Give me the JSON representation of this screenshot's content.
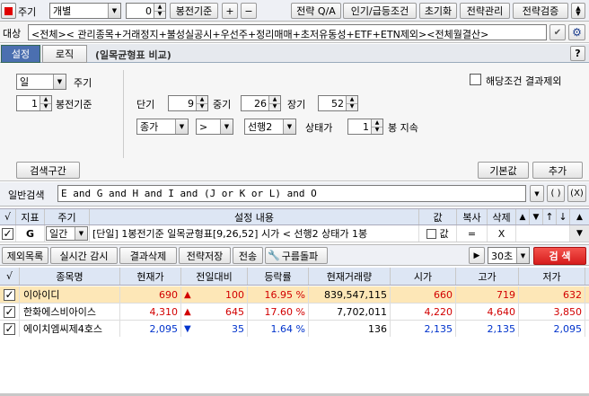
{
  "toolbar": {
    "icon_btn": "",
    "period_label": "주기",
    "period_value": "개별",
    "count_value": "0",
    "bongjeon_label": "봉전기준",
    "plus": "+",
    "minus": "−",
    "btn_strategy_qa": "전략 Q/A",
    "btn_popular": "인기/급등조건",
    "btn_reset": "초기화",
    "btn_manage": "전략관리",
    "btn_verify": "전략검증"
  },
  "target": {
    "label": "대상",
    "value": "<전체>< 관리종목+거래정지+불성실공시+우선주+정리매매+초저유동성+ETF+ETN제외><전체월결산>"
  },
  "tabs": {
    "settings": "설정",
    "logic": "로직",
    "title": "(일목균형표 비교)",
    "help": "?"
  },
  "settings": {
    "period_value": "일",
    "period_label": "주기",
    "bong_value": "1",
    "bong_label": "봉전기준",
    "exclude_label": "해당조건 결과제외",
    "short_label": "단기",
    "short_value": "9",
    "mid_label": "중기",
    "mid_value": "26",
    "long_label": "장기",
    "long_value": "52",
    "field1": "종가",
    "operator": ">",
    "field2": "선행2",
    "state_label": "상태가",
    "persist_value": "1",
    "persist_label": "봉 지속",
    "search_range_btn": "검색구간",
    "default_btn": "기본값",
    "add_btn": "추가"
  },
  "general": {
    "label": "일반검색",
    "formula": "E and G and H and I and (J or K or L) and O",
    "paren_btn": "( )",
    "x_btn": "(X)"
  },
  "cond_table": {
    "headers": [
      "√",
      "지표",
      "주기",
      "설정 내용",
      "값",
      "복사",
      "삭제"
    ],
    "row": {
      "indicator": "G",
      "period": "일간",
      "content": "[단일] 1봉전기준 일목균형표[9,26,52] 시가 < 선행2 상태가 1봉",
      "value_label": "값",
      "copy": "=",
      "delete": "X"
    }
  },
  "actions": {
    "exclude": "제외목록",
    "realtime": "실시간 감시",
    "result_delete": "결과삭제",
    "save": "전략저장",
    "send": "전송",
    "cloud": "구름돌파",
    "play": "▶",
    "count_value": "30초",
    "search": "검 색"
  },
  "results": {
    "headers": [
      "√",
      "종목명",
      "현재가",
      "전일대비",
      "등락률",
      "현재거래량",
      "시가",
      "고가",
      "저가"
    ],
    "rows": [
      {
        "name": "이아이디",
        "price": "690",
        "dir": "▲",
        "change": "100",
        "rate": "16.95 %",
        "volume": "839,547,115",
        "open": "660",
        "high": "719",
        "low": "632",
        "color": "red"
      },
      {
        "name": "한화에스비아이스",
        "price": "4,310",
        "dir": "▲",
        "change": "645",
        "rate": "17.60 %",
        "volume": "7,702,011",
        "open": "4,220",
        "high": "4,640",
        "low": "3,850",
        "color": "red"
      },
      {
        "name": "에이치엠씨제4호스",
        "price": "2,095",
        "dir": "▼",
        "change": "35",
        "rate": "1.64 %",
        "volume": "136",
        "open": "2,135",
        "high": "2,135",
        "low": "2,095",
        "color": "blue"
      }
    ]
  },
  "colors": {
    "accent": "#e8262a",
    "header_bg": "#dde6f4",
    "row_highlight": "#fde7b7",
    "red": "#d20000",
    "blue": "#0033cc"
  }
}
